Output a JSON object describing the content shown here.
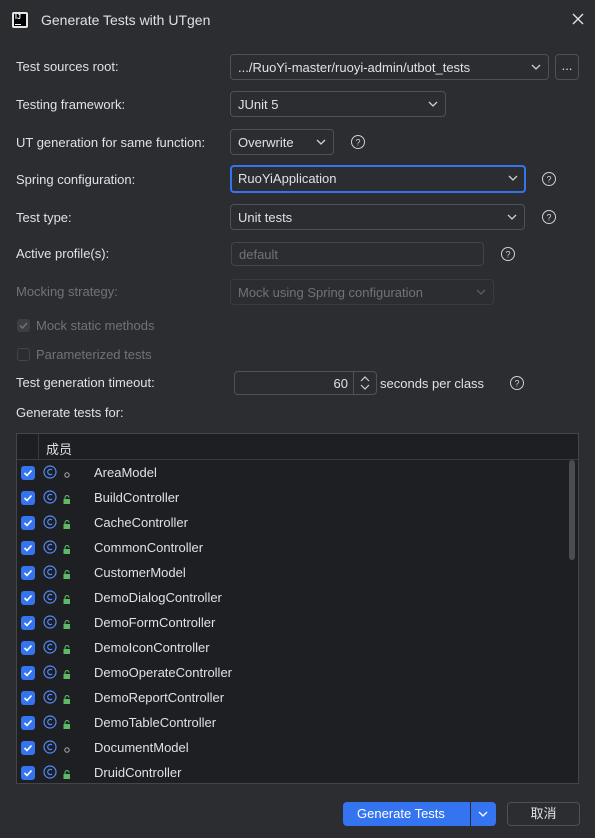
{
  "window": {
    "title": "Generate Tests with UTgen",
    "app_logo_text": "IJ"
  },
  "form": {
    "test_sources_root": {
      "label": "Test sources root:",
      "value": ".../RuoYi-master/ruoyi-admin/utbot_tests",
      "browse_label": "..."
    },
    "testing_framework": {
      "label": "Testing framework:",
      "value": "JUnit 5"
    },
    "ut_generation": {
      "label": "UT generation for same function:",
      "value": "Overwrite"
    },
    "spring_configuration": {
      "label": "Spring configuration:",
      "value": "RuoYiApplication"
    },
    "test_type": {
      "label": "Test type:",
      "value": "Unit tests"
    },
    "active_profiles": {
      "label": "Active profile(s):",
      "placeholder": "default"
    },
    "mocking_strategy": {
      "label": "Mocking strategy:",
      "value": "Mock using Spring configuration"
    },
    "mock_static_methods": {
      "label": "Mock static methods",
      "checked": true
    },
    "parameterized_tests": {
      "label": "Parameterized tests",
      "checked": false
    },
    "timeout": {
      "label": "Test generation timeout:",
      "value": "60",
      "suffix": "seconds per class"
    },
    "generate_for_label": "Generate tests for:"
  },
  "table": {
    "column_header": "成员",
    "rows": [
      {
        "name": "AreaModel",
        "visibility": "package",
        "checked": true
      },
      {
        "name": "BuildController",
        "visibility": "public",
        "checked": true
      },
      {
        "name": "CacheController",
        "visibility": "public",
        "checked": true
      },
      {
        "name": "CommonController",
        "visibility": "public",
        "checked": true
      },
      {
        "name": "CustomerModel",
        "visibility": "public",
        "checked": true
      },
      {
        "name": "DemoDialogController",
        "visibility": "public",
        "checked": true
      },
      {
        "name": "DemoFormController",
        "visibility": "public",
        "checked": true
      },
      {
        "name": "DemoIconController",
        "visibility": "public",
        "checked": true
      },
      {
        "name": "DemoOperateController",
        "visibility": "public",
        "checked": true
      },
      {
        "name": "DemoReportController",
        "visibility": "public",
        "checked": true
      },
      {
        "name": "DemoTableController",
        "visibility": "public",
        "checked": true
      },
      {
        "name": "DocumentModel",
        "visibility": "package",
        "checked": true
      },
      {
        "name": "DruidController",
        "visibility": "public",
        "checked": true
      }
    ]
  },
  "footer": {
    "generate_label": "Generate Tests",
    "cancel_label": "取消"
  },
  "colors": {
    "background": "#2b2d30",
    "accent": "#3574f0",
    "public_icon": "#5fb865",
    "class_icon": "#548af7"
  }
}
